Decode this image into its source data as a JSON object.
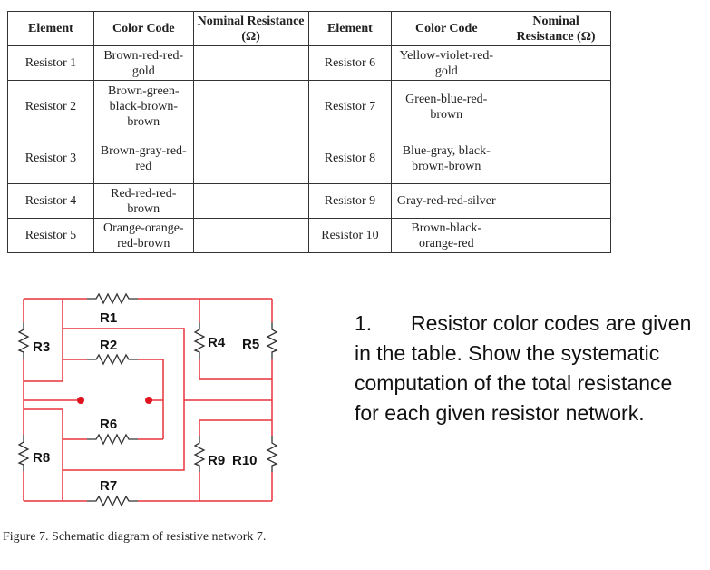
{
  "table": {
    "headers": [
      "Element",
      "Color Code",
      "Nominal Resistance (Ω)",
      "Element",
      "Color Code",
      "Nominal Resistance (Ω)"
    ],
    "rows": [
      {
        "left": {
          "element": "Resistor 1",
          "color_code": "Brown-red-red-gold",
          "nominal": ""
        },
        "right": {
          "element": "Resistor 6",
          "color_code": "Yellow-violet-red-gold",
          "nominal": ""
        }
      },
      {
        "left": {
          "element": "Resistor 2",
          "color_code": "Brown-green-black-brown-brown",
          "nominal": ""
        },
        "right": {
          "element": "Resistor 7",
          "color_code": "Green-blue-red-brown",
          "nominal": ""
        }
      },
      {
        "left": {
          "element": "Resistor 3",
          "color_code": "Brown-gray-red-red",
          "nominal": ""
        },
        "right": {
          "element": "Resistor 8",
          "color_code": "Blue-gray, black-brown-brown",
          "nominal": ""
        }
      },
      {
        "left": {
          "element": "Resistor 4",
          "color_code": "Red-red-red-brown",
          "nominal": ""
        },
        "right": {
          "element": "Resistor 9",
          "color_code": "Gray-red-red-silver",
          "nominal": ""
        }
      },
      {
        "left": {
          "element": "Resistor 5",
          "color_code": "Orange-orange-red-brown",
          "nominal": ""
        },
        "right": {
          "element": "Resistor 10",
          "color_code": "Brown-black-orange-red",
          "nominal": ""
        }
      }
    ]
  },
  "circuit": {
    "wire_color": "#e8343a",
    "resistor_color": "#333333",
    "terminal_color": "#e0141e",
    "labels": {
      "R1": "R1",
      "R2": "R2",
      "R3": "R3",
      "R4": "R4",
      "R5": "R5",
      "R6": "R6",
      "R7": "R7",
      "R8": "R8",
      "R9": "R9",
      "R10": "R10"
    }
  },
  "question": {
    "number": "1.",
    "text": "Resistor color codes are given in the table. Show the systematic computation of the total resistance for each given resistor network."
  },
  "caption": "Figure  7. Schematic diagram of resistive network 7."
}
